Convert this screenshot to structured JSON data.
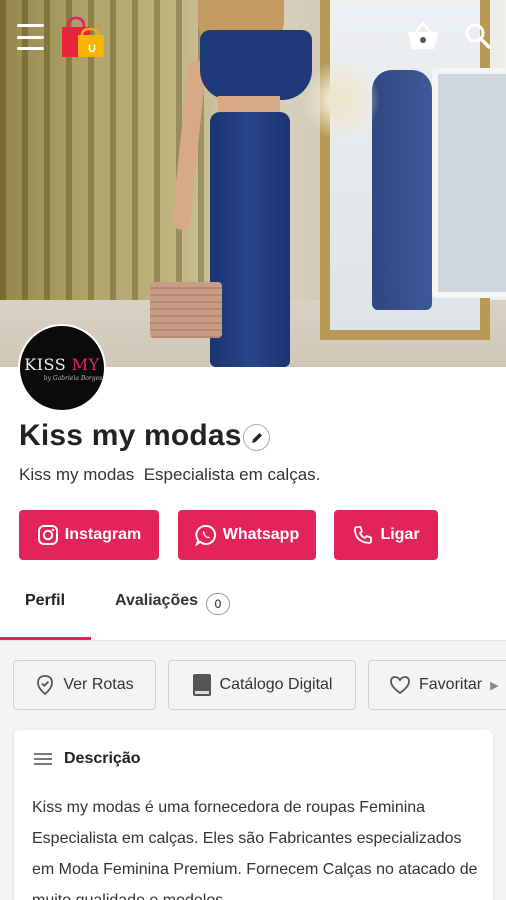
{
  "header": {
    "menu_icon": "hamburger-menu-icon",
    "logo_icon": "shopping-bags-logo-icon",
    "cart_icon": "basket-icon",
    "search_icon": "search-icon"
  },
  "avatar": {
    "brand_kiss": "KISS",
    "brand_my": " MY",
    "tagline": "by Gabriela Borges"
  },
  "store": {
    "name": "Kiss my modas",
    "subtitle": "Kiss my modas  Especialista em calças."
  },
  "actions": [
    {
      "label": "Instagram",
      "icon": "instagram-icon"
    },
    {
      "label": "Whatsapp",
      "icon": "whatsapp-icon"
    },
    {
      "label": "Ligar",
      "icon": "phone-icon"
    }
  ],
  "tabs": {
    "perfil": "Perfil",
    "avaliacoes": "Avaliações",
    "avaliacoes_count": "0"
  },
  "chips": [
    {
      "label": "Ver Rotas",
      "icon": "location-pin-icon"
    },
    {
      "label": "Catálogo Digital",
      "icon": "catalog-icon"
    },
    {
      "label": "Favoritar",
      "icon": "heart-icon"
    }
  ],
  "description": {
    "title": "Descrição",
    "text": "Kiss my modas  é uma fornecedora de roupas Feminina Especialista em calças. Eles são Fabricantes especializados em Moda Feminina Premium. Fornecem Calças no atacado de muito qualidade e modelos"
  },
  "colors": {
    "accent": "#e3245b",
    "avatar_bg": "#0b0b0b"
  }
}
